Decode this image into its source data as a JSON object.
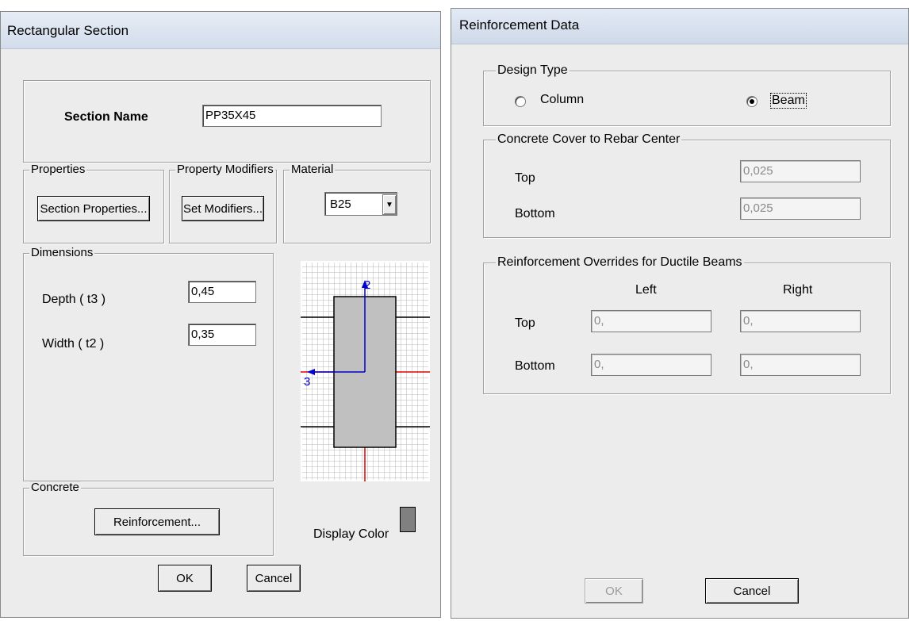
{
  "left_dialog": {
    "title": "Rectangular Section",
    "section_name_label": "Section Name",
    "section_name_value": "PP35X45",
    "properties_legend": "Properties",
    "section_properties_button": "Section Properties...",
    "property_modifiers_legend": "Property Modifiers",
    "set_modifiers_button": "Set Modifiers...",
    "material_legend": "Material",
    "material_value": "B25",
    "dimensions_legend": "Dimensions",
    "depth_label": "Depth ( t3 )",
    "depth_value": "0,45",
    "width_label": "Width ( t2 )",
    "width_value": "0,35",
    "axis_2_label": "2",
    "axis_3_label": "3",
    "concrete_legend": "Concrete",
    "reinforcement_button": "Reinforcement...",
    "display_color_label": "Display Color",
    "display_color": "#808080",
    "ok_button": "OK",
    "cancel_button": "Cancel"
  },
  "right_dialog": {
    "title": "Reinforcement Data",
    "design_type_legend": "Design Type",
    "column_option": "Column",
    "beam_option": "Beam",
    "selected_option": "Beam",
    "cover_legend": "Concrete Cover to Rebar Center",
    "cover_top_label": "Top",
    "cover_top_value": "0,025",
    "cover_bottom_label": "Bottom",
    "cover_bottom_value": "0,025",
    "overrides_legend": "Reinforcement Overrides for Ductile Beams",
    "left_header": "Left",
    "right_header": "Right",
    "override_top_label": "Top",
    "override_bottom_label": "Bottom",
    "top_left_value": "0,",
    "top_right_value": "0,",
    "bottom_left_value": "0,",
    "bottom_right_value": "0,",
    "ok_button": "OK",
    "cancel_button": "Cancel"
  }
}
